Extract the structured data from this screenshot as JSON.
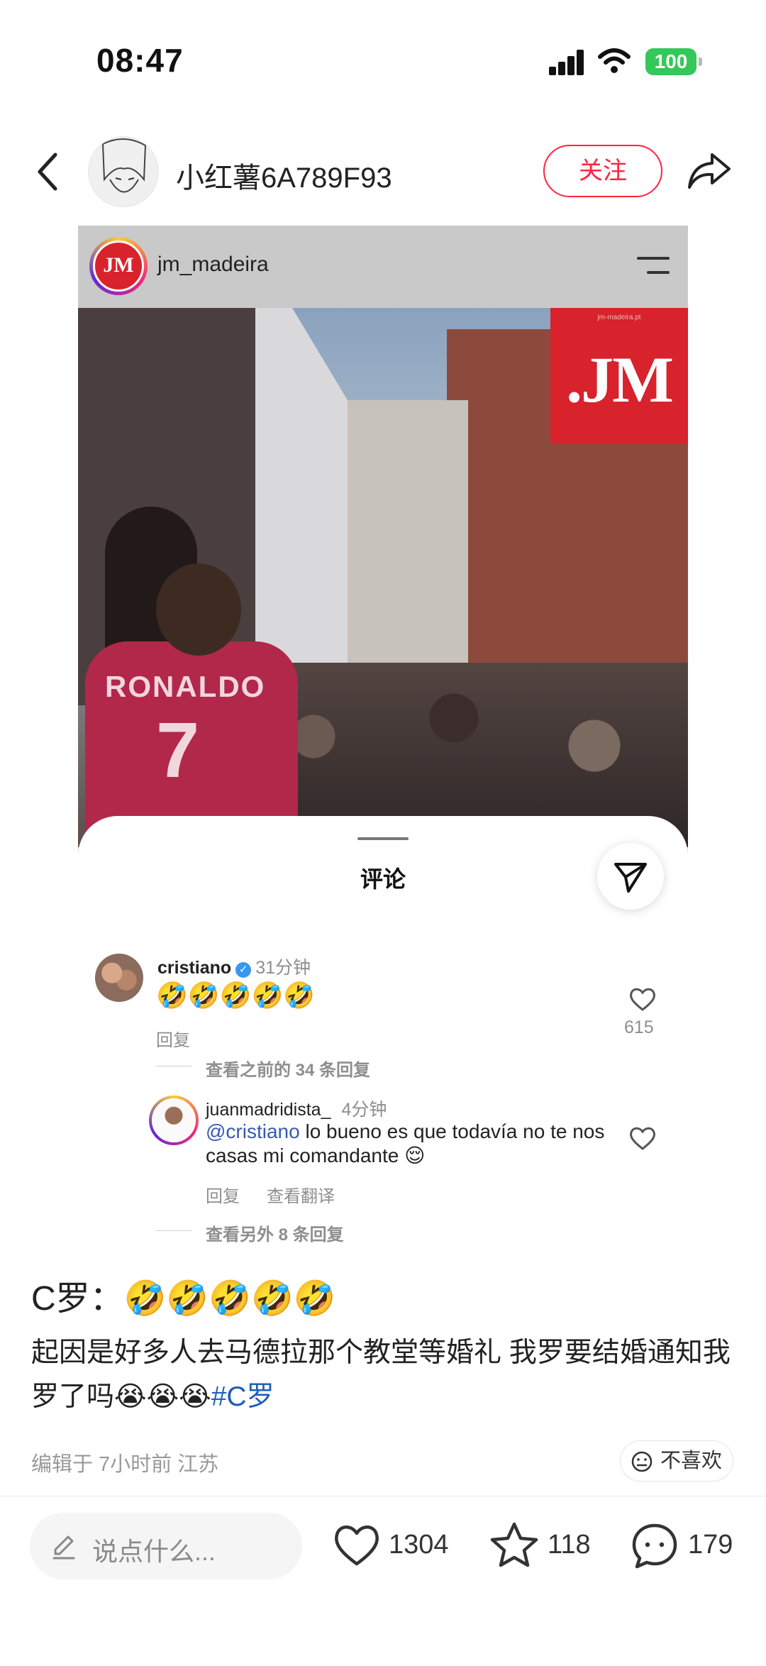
{
  "status_bar": {
    "time": "08:47",
    "battery": "100",
    "colors": {
      "battery": "#34c759"
    }
  },
  "header": {
    "username": "小红薯6A789F93",
    "follow_label": "关注",
    "colors": {
      "accent": "#ff2442"
    }
  },
  "screenshot": {
    "account": "jm_madeira",
    "logo_text": "JM",
    "brand_small": "jm-madeira.pt",
    "brand_big": ".JM",
    "shirt_name": "RONALDO",
    "shirt_number": "7",
    "sheet_title": "评论",
    "comments": [
      {
        "user": "cristiano",
        "verified": true,
        "time": "31分钟",
        "text": "🤣🤣🤣🤣🤣",
        "reply": "回复",
        "likes": "615"
      },
      {
        "user": "juanmadridista_",
        "time": "4分钟",
        "mention": "@cristiano",
        "text": " lo bueno es que todavía no te nos casas mi comandante 😌",
        "reply": "回复",
        "translate": "查看翻译"
      }
    ],
    "view_previous": "查看之前的 34 条回复",
    "view_more": "查看另外 8 条回复"
  },
  "caption": {
    "title": "C罗：🤣🤣🤣🤣🤣",
    "body": "起因是好多人去马德拉那个教堂等婚礼 我罗要结婚通知我罗了吗😭😭😭",
    "hashtag": "#C罗",
    "meta": "编辑于 7小时前 江苏",
    "dislike_label": "不喜欢"
  },
  "bottom_bar": {
    "input_placeholder": "说点什么...",
    "likes": "1304",
    "collects": "118",
    "comments": "179"
  }
}
